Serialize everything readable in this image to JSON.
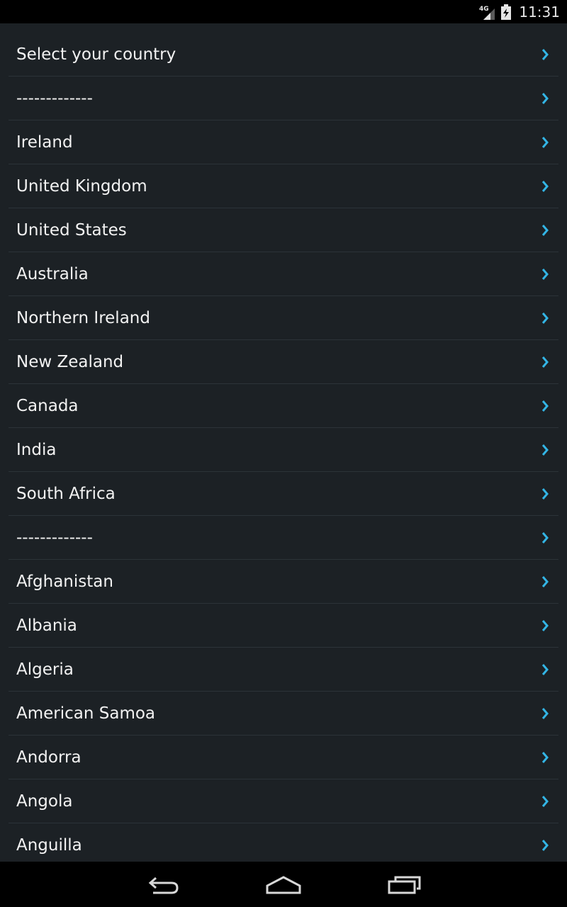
{
  "status_bar": {
    "network_label": "4G",
    "time": "11:31",
    "signal_icon": "signal-bars-icon",
    "battery_icon": "battery-charging-icon"
  },
  "countries": [
    "Select your country",
    "-------------",
    "Ireland",
    "United Kingdom",
    "United States",
    "Australia",
    "Northern Ireland",
    "New Zealand",
    "Canada",
    "India",
    "South Africa",
    "-------------",
    "Afghanistan",
    "Albania",
    "Algeria",
    "American Samoa",
    "Andorra",
    "Angola",
    "Anguilla"
  ],
  "row_icon": "chevron-right-icon",
  "nav_bar": {
    "back_icon": "back-icon",
    "home_icon": "home-icon",
    "recents_icon": "recent-apps-icon"
  },
  "colors": {
    "background": "#1c2125",
    "divider": "#2c3338",
    "chevron": "#33b5e5",
    "text": "#f2f2f2"
  }
}
